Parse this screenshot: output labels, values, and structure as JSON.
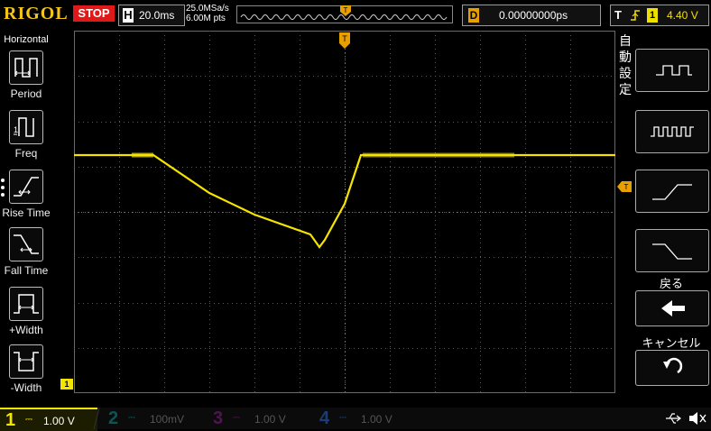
{
  "topbar": {
    "brand": "RIGOL",
    "run_state": "STOP",
    "horizontal_key": "H",
    "timebase": "20.0ms",
    "sample_rate": "25.0MSa/s",
    "memory_depth": "6.00M pts",
    "trigger_marker": "T",
    "delay_key": "D",
    "delay_value": "0.00000000ps",
    "trigger_key": "T",
    "trigger_level": "4.40 V"
  },
  "left_menu": {
    "title": "Horizontal",
    "items": [
      {
        "label": "Period",
        "icon": "period-icon"
      },
      {
        "label": "Freq",
        "icon": "frequency-icon"
      },
      {
        "label": "Rise Time",
        "icon": "rise-time-icon"
      },
      {
        "label": "Fall Time",
        "icon": "fall-time-icon"
      },
      {
        "label": "+Width",
        "icon": "positive-width-icon"
      },
      {
        "label": "-Width",
        "icon": "negative-width-icon"
      }
    ]
  },
  "right_menu": {
    "auto_label": "自動設定",
    "buttons": [
      {
        "icon": "square-wave-icon"
      },
      {
        "icon": "multi-pulse-icon"
      },
      {
        "icon": "rising-edge-icon"
      },
      {
        "icon": "falling-edge-icon"
      }
    ],
    "back_label": "戻る",
    "cancel_label": "キャンセル"
  },
  "markers": {
    "channel1": "1",
    "trigger_pos": "T",
    "trigger_level": "T"
  },
  "channels": [
    {
      "num": "1",
      "value": "1.00 V",
      "color": "#f5e400"
    },
    {
      "num": "2",
      "value": "100mV",
      "color": "#0ea5a5"
    },
    {
      "num": "3",
      "value": "1.00 V",
      "color": "#c020c0"
    },
    {
      "num": "4",
      "value": "1.00 V",
      "color": "#2a6fd6"
    }
  ],
  "colors": {
    "trace": "#f5e400",
    "stop": "#e01818",
    "trigger": "#e8a000",
    "grid": "#5a5a5a"
  }
}
